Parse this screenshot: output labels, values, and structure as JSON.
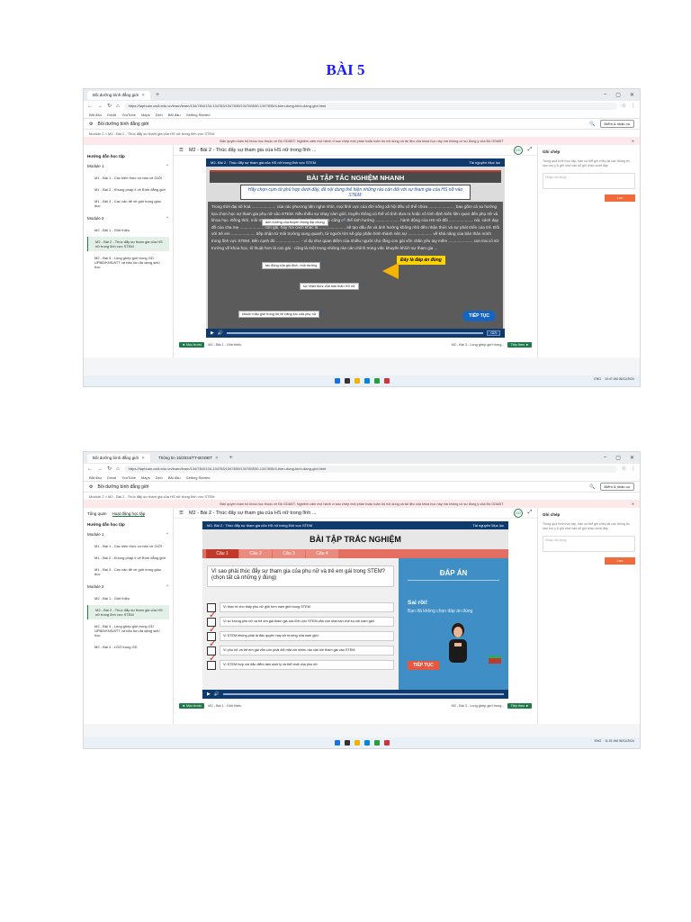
{
  "page_title": "BÀI 5",
  "shared": {
    "tab_title": "Bồi dưỡng bình đẳng giới",
    "url": "https://taphuan.csdl.edu.vn/learn/learn/134/78/4/134-134783/1347830/134783530-1347835/4-bien-dong-binh-dang-gioi.html",
    "bookmarks": [
      "Bắt đầu",
      "Gmail",
      "YouTube",
      "Maps",
      "Dịch",
      "Bắt đầu",
      "Getting Started"
    ],
    "site_title": "Bồi dưỡng bình đẳng giới",
    "eval_btn": "Điểm & nhận xu",
    "breadcrumb": "Module 2 > M2 - Bài 2 - Thúc đẩy sự tham gia của HS nữ trong lĩnh vực STEM",
    "notice": "Bản quyền toàn bộ khóa học thuộc về Bộ GD&ĐT. Nghiêm cấm mọi hành vi sao chép một phần hoặc toàn bộ nội dung và tài liệu của khóa học này mà không có sự đồng ý của Bộ GD&ĐT",
    "sb_tabs": [
      "Tổng quan",
      "Hoạt động học tập"
    ],
    "sb_title": "Hướng dẫn học tập",
    "module1": "Module 1",
    "m1_items": [
      "M1 - Bài 1 - Các kiến thức cơ bản về GIỚI",
      "M1 - Bài 2 - Khung pháp lí về Bình đẳng giới",
      "M1 - Bài 3 - Các vấn đề về giới trong giáo dục"
    ],
    "module2": "Module 2",
    "m2_items": [
      "M2 - Bài 1 - Giới thiệu",
      "M2 - Bài 2 - Thúc đẩy sự tham gia của HS nữ trong lĩnh vực STEM",
      "M2 - Bài 3 - Lồng ghép giới trong GD UPBD/KNS/ATT và bảo tồn đa dạng sinh học"
    ],
    "m2_extra": "M2 - Bài 4 - LGG trong GD",
    "lesson_title": "M2 - Bài 2 - Thúc đẩy sự tham gia của HS nữ trong lĩnh ...",
    "progress_badge": "100",
    "player_title": "M2- Bài 2 : Thúc đẩy sự tham gia của HS nữ trong lĩnh vực STEM",
    "player_links": "Tài nguyên   Mục lục",
    "submit": "GỬI",
    "prev_btn": "◄ Mục trước",
    "prev_label": "M2 - Bài 1 - Giới thiệu",
    "next_label": "M2 - Bài 3 - Lồng ghép giới trong...",
    "next_btn": "Tiếp theo ►",
    "notes_title": "Ghi chép",
    "notes_hint": "Trong quá trình học tập, bạn có thể ghi chép lại các thông tin cần lưu ý & ghi nhớ vào sổ ghi chép dưới đây",
    "notes_placeholder": "Nhập nội dung",
    "save_btn": "Lưu",
    "tray_lang": "ENG",
    "tray_time1": "10:47 AM 06/11/2024",
    "tray_time2": "11:01 AM 06/11/2024",
    "tab2_title": "Thông tin 15/2024/TT-BGDĐT"
  },
  "slide1": {
    "heading": "BÀI TẬP TẮC NGHIỆM NHANH",
    "ask": "Hãy chọn cụm từ phù hợp dưới đây, để nội dung thể hiện những rào cản đối với sự tham gia của HS nữ vào STEM:",
    "paragraph": "Trong thời đại số hoá ..................... của các phương tiện nghe nhìn, mọi lĩnh vực của đời sống xã hội đều có thể chứa ..................... , bao gồm cả xu hướng lựa chọn học sự tham gia phụ nữ vào STEM. Nếu thiếu sự nhạy cảm giới, truyền thông có thể vô tình đưa ra hoặc vô tình định kiến liên quan đến phụ nữ và khoa học. Đồng thời, môi trường giáo dục và trải nghiệm lớp học cũng có thể ảnh hưởng ..................... hành động của HS nữ đối ..................... nói, cách dạy đồ của cha mẹ ..................... con gái, hay nói cách khác là ..................... , sẽ tạo dấu ấn và ảnh hưởng không nhỏ đến nhận thức và sự phát triển của trẻ. Đối với trẻ em ..................... tiếp nhận từ môi trường xung quanh, từ người lớn sẽ góp phần hình thành nên sự ..................... về khả năng của bản thân mình trong lĩnh vực STEM. Bên cạnh đó ..................... - ví dụ như quan điểm của nhiều người cho rằng con gái vốn chăn yêu tay mềm ..................... con trai có sở trường về khoa học, kĩ thuật hơn là con gái - cũng là một trong những rào cản chính trong việc khuyến khích sự tham gia ...",
    "chips": [
      "ảnh hưởng của truyền thông đại chúng",
      "tác động của gia đình, nhà trường",
      "sự nhận thức của bản thân HS nữ",
      "khuôn mẫu giới trong lời về năng lực của phụ nữ"
    ],
    "callout": "Đây là đáp án đúng",
    "continue": "TIẾP TỤC",
    "counter": "1/1"
  },
  "slide2": {
    "heading": "BÀI TẬP TRẮC NGHIỆM",
    "tabs": [
      "Câu 1",
      "Câu 2",
      "Câu 3",
      "Câu 4"
    ],
    "question": "Vì sao phải thúc đẩy sự tham gia của phụ nữ và trẻ em gái trong STEM? (chọn tất cả những ý đúng)",
    "options": [
      "Vì thực tế cho thấy phụ nữ giỏi hơn nam giới trong STEM.",
      "Vì số lượng phụ nữ và trẻ em gái tham gia các lĩnh vực STEM vẫn còn khá hạn chế so với nam giới.",
      "Vì STEM không phải là đặc quyền hay sở trường của nam giới.",
      "Vì phụ nữ và trẻ em gái vẫn còn phải đối mặt với nhiều rào cản khi tham gia vào STEM.",
      "Vì STEM hợp với đặc điểm tâm sinh lý và thể chất của phụ nữ."
    ],
    "answer_title": "ĐÁP ÁN",
    "result": "Sai rồi!",
    "result_msg": "Bạn đã không chọn đáp án đúng",
    "continue": "TIẾP TỤC",
    "counter": "1/4"
  }
}
